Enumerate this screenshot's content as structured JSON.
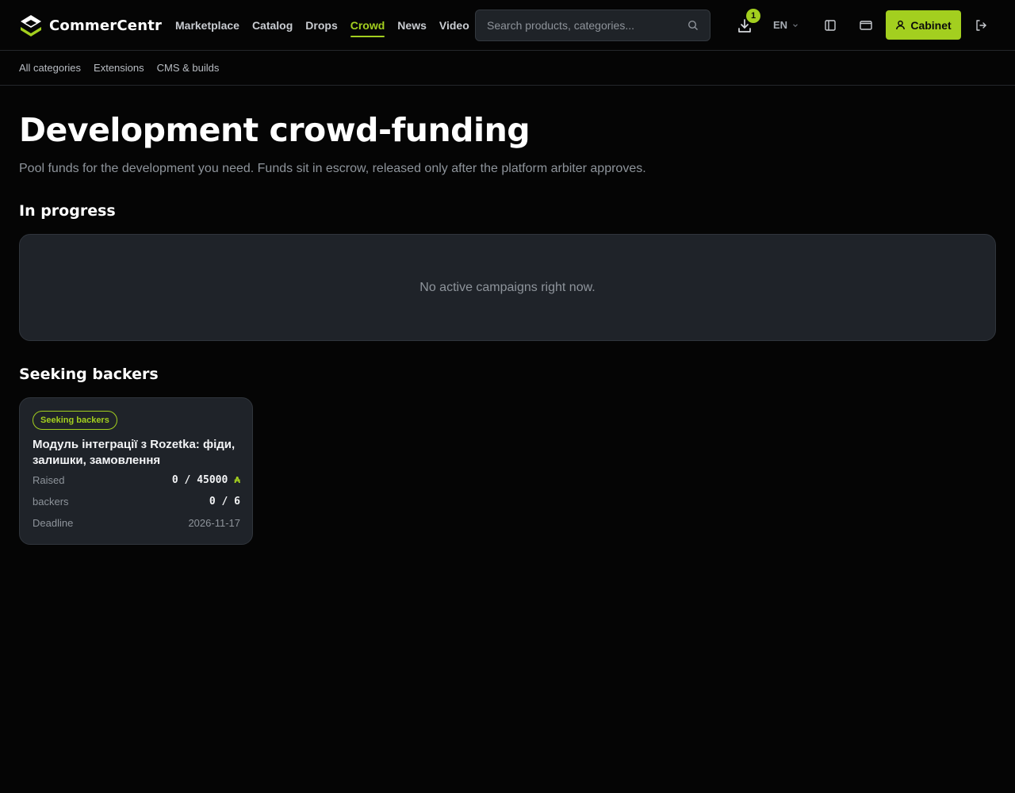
{
  "app": {
    "name": "CommerCentr",
    "accent_color": "#a3cf1f",
    "background_color": "#050505"
  },
  "nav": {
    "items": [
      {
        "label": "Marketplace",
        "active": false
      },
      {
        "label": "Catalog",
        "active": false
      },
      {
        "label": "Drops",
        "active": false
      },
      {
        "label": "Crowd",
        "active": true
      },
      {
        "label": "News",
        "active": false
      },
      {
        "label": "Video",
        "active": false
      }
    ]
  },
  "search": {
    "placeholder": "Search products, categories...",
    "value": "",
    "icon": "search-icon"
  },
  "header": {
    "downloads_icon": "download-icon",
    "downloads_count": "1",
    "language": "EN",
    "panel_icon": "sidebar-panel-icon",
    "window_icon": "window-icon",
    "cabinet_label": "Cabinet",
    "cabinet_icon": "user-icon",
    "logout_icon": "logout-icon"
  },
  "subnav": {
    "items": [
      "All categories",
      "Extensions",
      "CMS & builds"
    ]
  },
  "page": {
    "title": "Development crowd-funding",
    "subtitle": "Pool funds for the development you need. Funds sit in escrow, released only after the platform arbiter approves."
  },
  "in_progress": {
    "title": "In progress",
    "empty_text": "No active campaigns right now."
  },
  "seeking": {
    "title": "Seeking backers",
    "cards": [
      {
        "status": "Seeking backers",
        "title": "Модуль інтеграції з Rozetka: фіди, залишки, замовлення",
        "raised_label": "Raised",
        "raised_value": "0 / 45000",
        "currency_symbol": "₳",
        "backers_label": "backers",
        "backers_value": "0 / 6",
        "deadline_label": "Deadline",
        "deadline_value": "2026-11-17"
      }
    ]
  }
}
